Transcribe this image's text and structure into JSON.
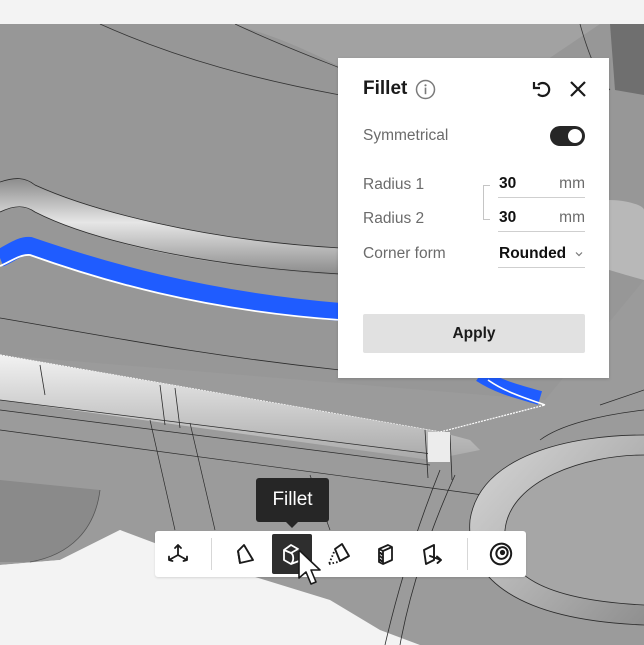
{
  "panel": {
    "title": "Fillet",
    "icons": {
      "info": "info-icon",
      "reset": "undo-icon",
      "close": "close-icon"
    },
    "symmetrical": {
      "label": "Symmetrical",
      "enabled": true
    },
    "radius1": {
      "label": "Radius 1",
      "value": "30",
      "unit": "mm"
    },
    "radius2": {
      "label": "Radius 2",
      "value": "30",
      "unit": "mm"
    },
    "corner_form": {
      "label": "Corner form",
      "value": "Rounded"
    },
    "apply_label": "Apply"
  },
  "tooltip": {
    "text": "Fillet"
  },
  "toolbar": {
    "tools": [
      {
        "name": "transform",
        "icon": "move-axes-icon",
        "active": false
      },
      {
        "name": "chamfer",
        "icon": "chamfer-icon",
        "active": false
      },
      {
        "name": "fillet",
        "icon": "fillet-icon",
        "active": true
      },
      {
        "name": "draft",
        "icon": "draft-icon",
        "active": false
      },
      {
        "name": "shell",
        "icon": "shell-icon",
        "active": false
      },
      {
        "name": "offset-face",
        "icon": "offset-face-icon",
        "active": false
      },
      {
        "name": "hole",
        "icon": "hole-icon",
        "active": false
      }
    ]
  },
  "colors": {
    "accent_selection": "#1f5cff",
    "panel_bg": "#ffffff",
    "toggle_on": "#262626",
    "apply_bg": "#e1e1e1",
    "tooltip_bg": "#262626",
    "model_gray": "#9a9a9a",
    "background": "#f3f3f3"
  }
}
